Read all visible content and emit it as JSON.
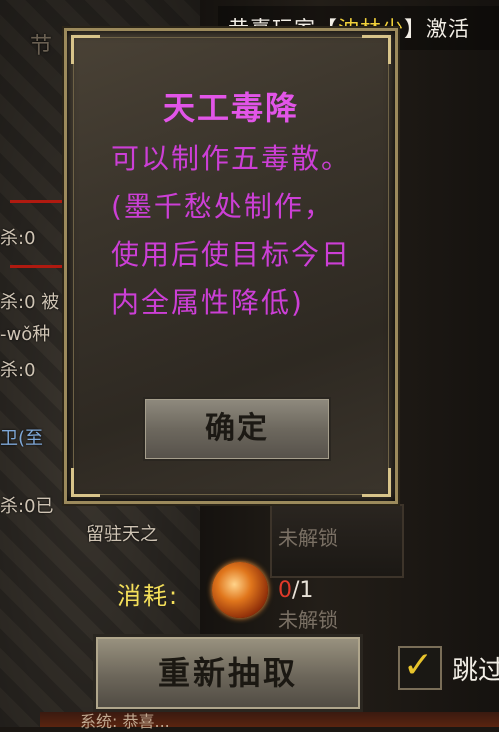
{
  "announcement": {
    "prefix": "恭喜玩家【",
    "player": "沈林少",
    "suffix": "】激活"
  },
  "background_left": {
    "lines": [
      "杀:0",
      "杀:0 被",
      "-wǒ种",
      "杀:0",
      "卫(至",
      "杀:0已",
      "留驻天之"
    ],
    "top_label": "节"
  },
  "slots": {
    "locked_label_1": "未解锁",
    "locked_label_2": "未解锁"
  },
  "dialog": {
    "title": "天工毒降",
    "body": "可以制作五毒散。(墨千愁处制作，使用后使目标今日内全属性降低)",
    "confirm_label": "确定"
  },
  "cost": {
    "label": "消耗:",
    "icon": "poison-orb-icon",
    "have": "0",
    "need": "/1"
  },
  "actions": {
    "redraw_label": "重新抽取",
    "skip_label": "跳过",
    "skip_checked": true
  },
  "bottom_strip": {
    "text": "系统: 恭喜..."
  },
  "colors": {
    "dialog_text": "#cc3fd6",
    "dialog_title": "#e255e8",
    "player_name": "#f3d23a",
    "cost_label": "#f5e05a",
    "zero_count": "#e03a2a"
  }
}
